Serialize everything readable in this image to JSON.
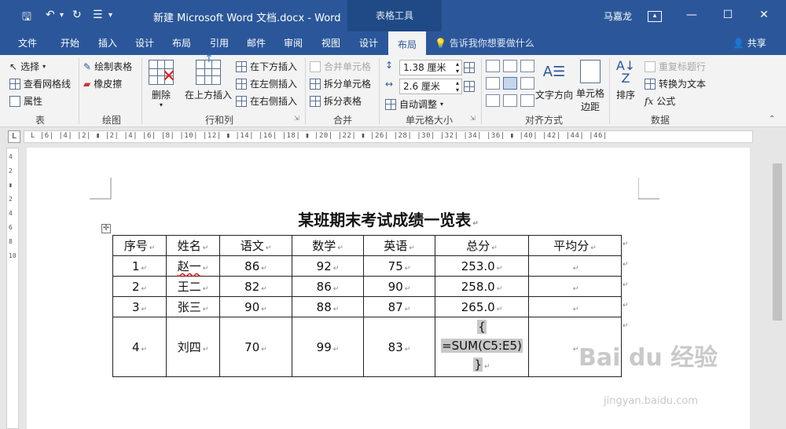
{
  "titlebar": {
    "title": "新建 Microsoft Word 文档.docx - Word",
    "context_tab": "表格工具",
    "user": "马嘉龙",
    "save_icon": "save-icon",
    "undo_icon": "undo-icon",
    "redo_icon": "redo-icon",
    "customize_icon": "customize-qat-icon"
  },
  "tabs": [
    {
      "label": "文件"
    },
    {
      "label": "开始"
    },
    {
      "label": "插入"
    },
    {
      "label": "设计"
    },
    {
      "label": "布局"
    },
    {
      "label": "引用"
    },
    {
      "label": "邮件"
    },
    {
      "label": "审阅"
    },
    {
      "label": "视图"
    },
    {
      "label": "设计"
    },
    {
      "label": "布局"
    }
  ],
  "tell_me": "告诉我你想要做什么",
  "share": "共享",
  "ribbon": {
    "table_group": {
      "label": "表",
      "select": "选择",
      "view_gridlines": "查看网格线",
      "properties": "属性"
    },
    "draw_group": {
      "label": "绘图",
      "draw_table": "绘制表格",
      "eraser": "橡皮擦"
    },
    "rows_cols_group": {
      "label": "行和列",
      "delete": "删除",
      "insert_above": "在上方插入",
      "insert_below": "在下方插入",
      "insert_left": "在左侧插入",
      "insert_right": "在右侧插入"
    },
    "merge_group": {
      "label": "合并",
      "merge_cells": "合并单元格",
      "split_cells": "拆分单元格",
      "split_table": "拆分表格"
    },
    "cell_size_group": {
      "label": "单元格大小",
      "height_value": "1.38 厘米",
      "width_value": "2.6 厘米",
      "autofit": "自动调整"
    },
    "alignment_group": {
      "label": "对齐方式",
      "text_direction": "文字方向",
      "cell_margins_1": "单元格",
      "cell_margins_2": "边距"
    },
    "data_group": {
      "label": "数据",
      "sort": "排序",
      "repeat_header": "重复标题行",
      "convert_to_text": "转换为文本",
      "formula": "公式"
    }
  },
  "ruler_marks": "L  |6| |4| |2| ▮ |2| |4| |6| |8| |10| |12| ▮ |14| |16| |18| ▮ |20| |22| ▮ |26| |28| |30| |32| |34| |36| ▮ |40| |42| |44| |46|",
  "vruler_marks": "4 2 ▮ 2 4 6 8 10",
  "document": {
    "title": "某班期末考试成绩一览表",
    "headers": [
      "序号",
      "姓名",
      "语文",
      "数学",
      "英语",
      "总分",
      "平均分"
    ],
    "rows": [
      [
        "1",
        "赵一",
        "86",
        "92",
        "75",
        "253.0",
        ""
      ],
      [
        "2",
        "王二",
        "82",
        "86",
        "90",
        "258.0",
        ""
      ],
      [
        "3",
        "张三",
        "90",
        "88",
        "87",
        "265.0",
        ""
      ]
    ],
    "last_row": {
      "index": "4",
      "name": "刘四",
      "chinese": "70",
      "math": "99",
      "english": "83",
      "field_open": "{",
      "field_code": "=SUM(C5:E5)",
      "field_close": "}",
      "average": ""
    },
    "cell_mark": "↵"
  },
  "watermark": {
    "brand": "Bai du 经验",
    "url": "jingyan.baidu.com"
  }
}
